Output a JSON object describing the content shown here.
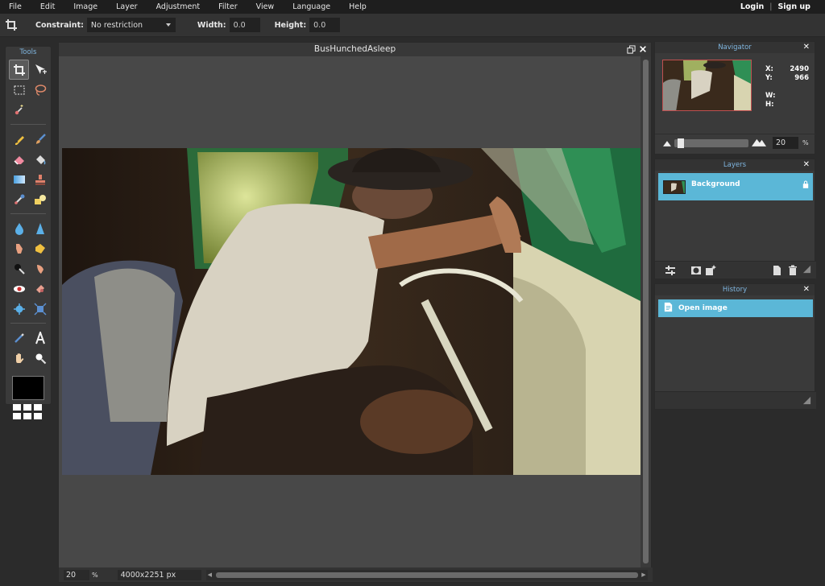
{
  "menu": {
    "items": [
      "File",
      "Edit",
      "Image",
      "Layer",
      "Adjustment",
      "Filter",
      "View",
      "Language",
      "Help"
    ],
    "login": "Login",
    "separator": "|",
    "signup": "Sign up"
  },
  "options": {
    "constraint_label": "Constraint:",
    "constraint_value": "No restriction",
    "width_label": "Width:",
    "width_value": "0.0",
    "height_label": "Height:",
    "height_value": "0.0"
  },
  "tools": {
    "title": "Tools",
    "icons": [
      "crop-icon",
      "move-icon",
      "marquee-icon",
      "lasso-icon",
      "magic-wand-icon",
      "pencil-icon",
      "brush-icon",
      "eraser-icon",
      "paint-bucket-icon",
      "gradient-icon",
      "clone-stamp-icon",
      "color-replace-icon",
      "drawing-icon",
      "blur-icon",
      "sharpen-icon",
      "smudge-icon",
      "sponge-icon",
      "dodge-icon",
      "burn-icon",
      "red-eye-icon",
      "spot-heal-icon",
      "bloat-icon",
      "pinch-icon",
      "color-picker-icon",
      "type-icon",
      "hand-icon",
      "zoom-icon"
    ],
    "foreground_color": "#000000"
  },
  "document": {
    "title": "BusHunchedAsleep",
    "zoom": "20",
    "zoom_unit": "%",
    "dimensions": "4000x2251 px"
  },
  "navigator": {
    "title": "Navigator",
    "x_label": "X:",
    "x_value": "2490",
    "y_label": "Y:",
    "y_value": "966",
    "w_label": "W:",
    "w_value": "",
    "h_label": "H:",
    "h_value": "",
    "zoom_value": "20",
    "zoom_unit": "%",
    "zoom_slider_fraction": 0.05
  },
  "layers": {
    "title": "Layers",
    "items": [
      {
        "name": "Background",
        "locked": true
      }
    ]
  },
  "history": {
    "title": "History",
    "items": [
      {
        "name": "Open image"
      }
    ]
  },
  "colors": {
    "accent": "#5bb7d7",
    "panel_title": "#7fb6e0"
  }
}
